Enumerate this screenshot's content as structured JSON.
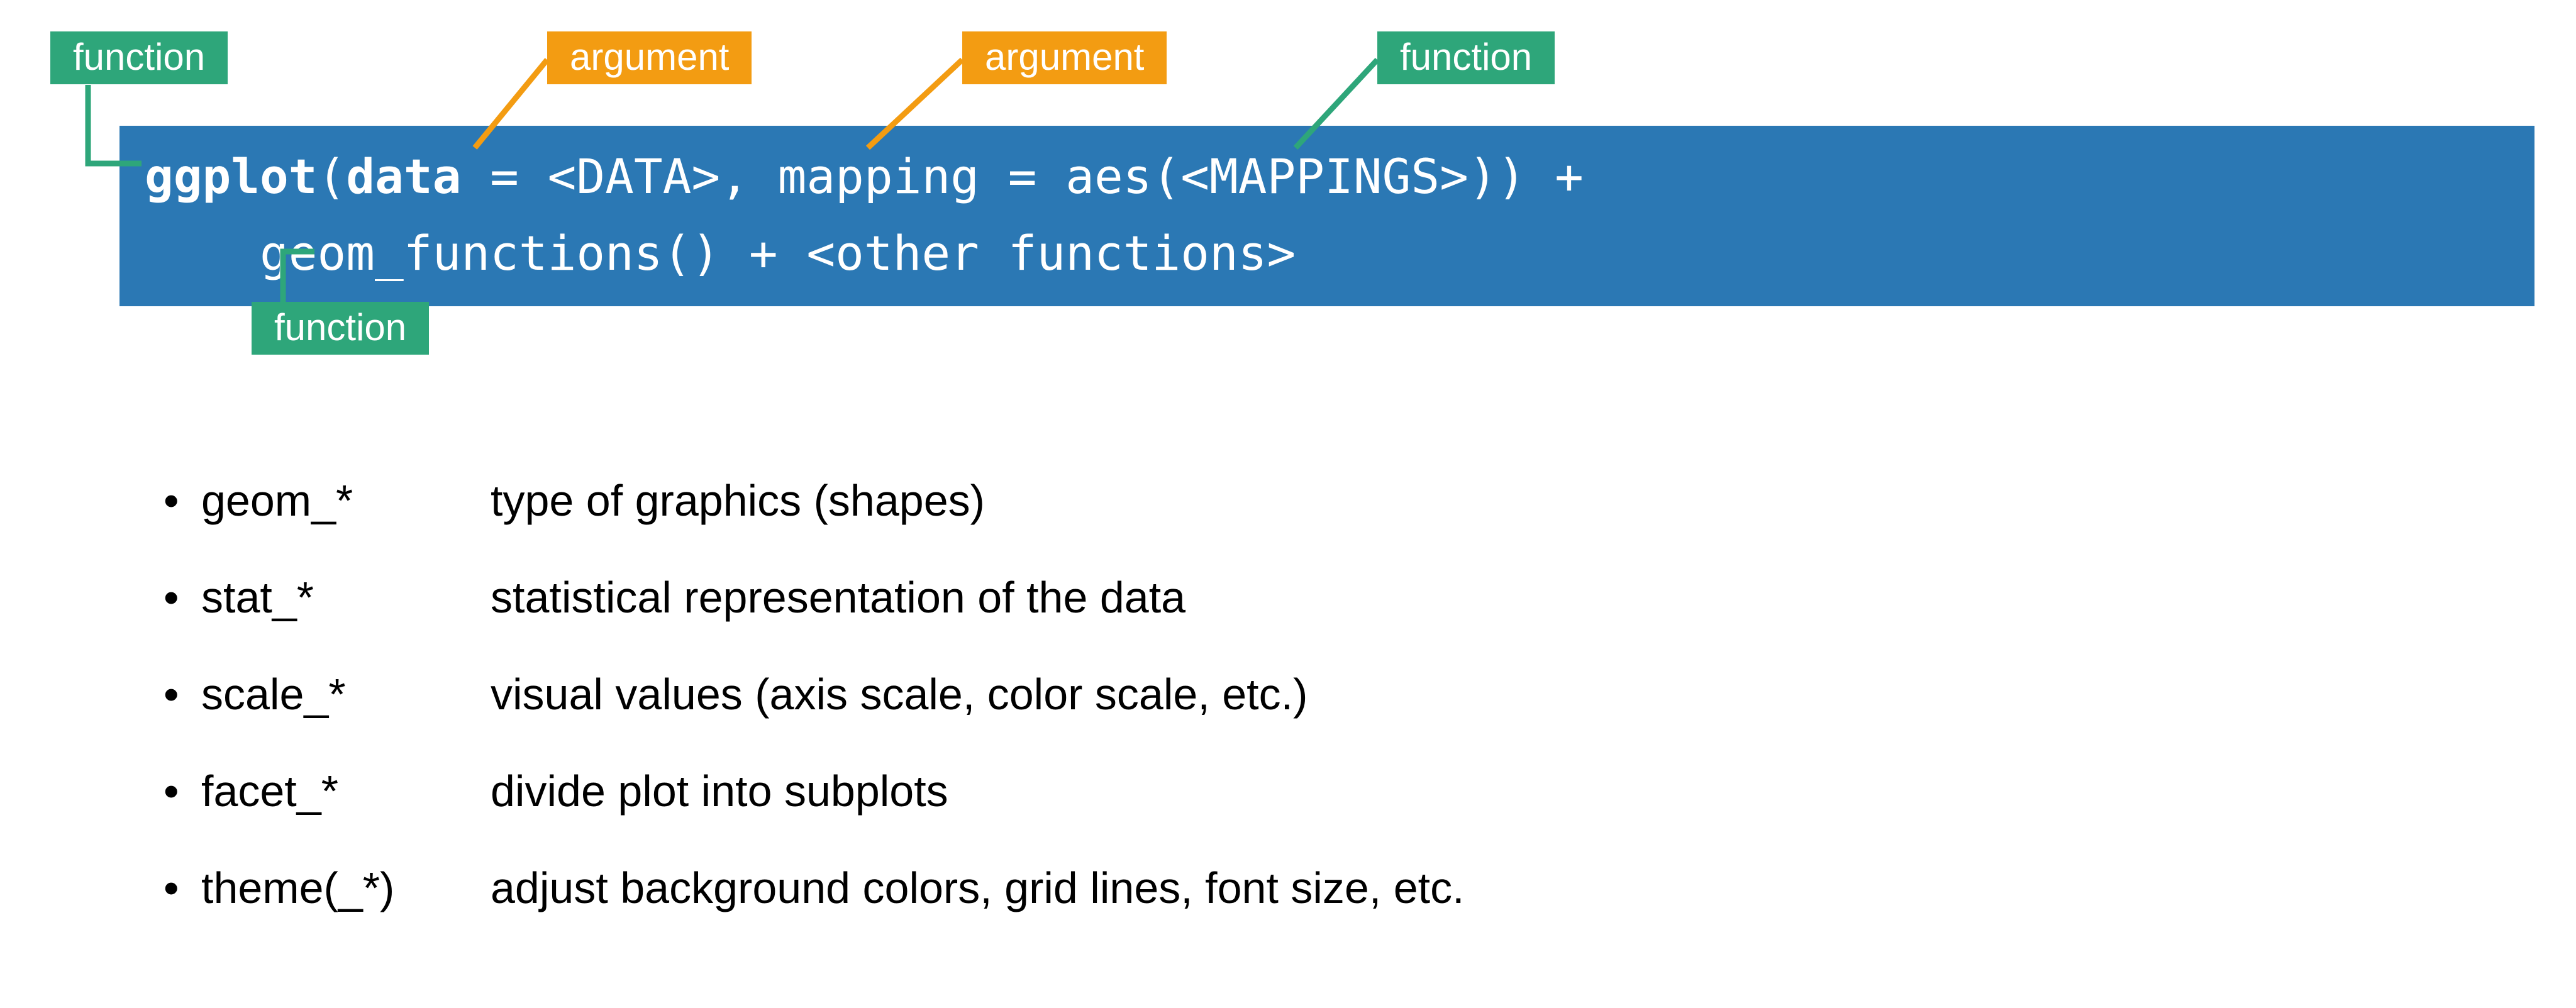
{
  "tags": {
    "function_top_left": "function",
    "argument_left": "argument",
    "argument_right": "argument",
    "function_top_right": "function",
    "function_below": "function"
  },
  "code": {
    "prefix": "ggplot",
    "open_paren": "(",
    "data_kw": "data",
    "eq1": " = <DATA>, ",
    "mapping_kw": "mapping",
    "eq2": " = ",
    "aes": "aes",
    "aes_args": "(<MAPPINGS>)",
    "close_paren_plus": ") +",
    "line2_indent": "    ",
    "line2_geom": "geom_functions()",
    "line2_plus": " + ",
    "line2_other": "<other functions>"
  },
  "bullets": [
    {
      "term": "geom_*",
      "desc": "type of graphics (shapes)"
    },
    {
      "term": "stat_*",
      "desc": "statistical representation of the data"
    },
    {
      "term": "scale_*",
      "desc": "visual values (axis scale, color scale, etc.)"
    },
    {
      "term": "facet_*",
      "desc": "divide plot into subplots"
    },
    {
      "term": "theme(_*)",
      "desc": "adjust background colors, grid lines, font size, etc."
    }
  ],
  "colors": {
    "green": "#2ea67a",
    "orange": "#f39c12",
    "blue": "#2b78b4"
  }
}
